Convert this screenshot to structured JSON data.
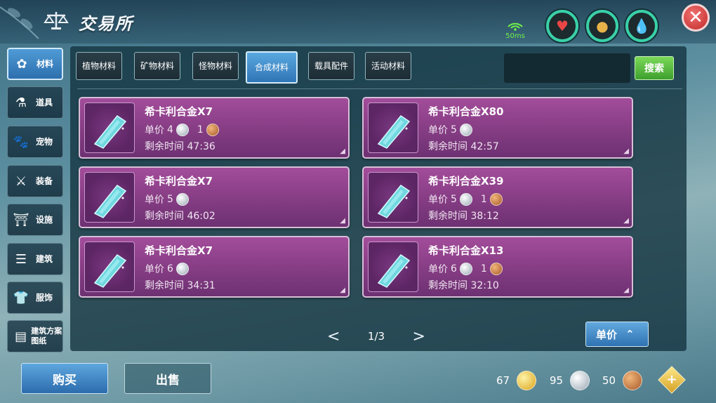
{
  "header": {
    "title": "交易所",
    "ping": "50ms"
  },
  "categories": [
    {
      "label": "材料",
      "icon": "materials-icon",
      "active": true
    },
    {
      "label": "道具",
      "icon": "potion-icon",
      "active": false
    },
    {
      "label": "宠物",
      "icon": "paw-icon",
      "active": false
    },
    {
      "label": "装备",
      "icon": "equipment-icon",
      "active": false
    },
    {
      "label": "设施",
      "icon": "facility-icon",
      "active": false
    },
    {
      "label": "建筑",
      "icon": "building-icon",
      "active": false
    },
    {
      "label": "服饰",
      "icon": "clothing-icon",
      "active": false
    },
    {
      "label": "建筑方案图纸",
      "icon": "blueprint-icon",
      "active": false
    }
  ],
  "subtabs": [
    {
      "label": "植物材料",
      "active": false
    },
    {
      "label": "矿物材料",
      "active": false
    },
    {
      "label": "怪物材料",
      "active": false
    },
    {
      "label": "合成材料",
      "active": true
    },
    {
      "label": "载具配件",
      "active": false
    },
    {
      "label": "活动材料",
      "active": false
    }
  ],
  "search": {
    "button_label": "搜索",
    "placeholder": ""
  },
  "listings": [
    {
      "name": "希卡利合金X7",
      "price_label": "单价",
      "silver": "4",
      "bronze": "1",
      "time_label": "剩余时间",
      "time": "47:36"
    },
    {
      "name": "希卡利合金X80",
      "price_label": "单价",
      "silver": "5",
      "bronze": "",
      "time_label": "剩余时间",
      "time": "42:57"
    },
    {
      "name": "希卡利合金X7",
      "price_label": "单价",
      "silver": "5",
      "bronze": "",
      "time_label": "剩余时间",
      "time": "46:02"
    },
    {
      "name": "希卡利合金X39",
      "price_label": "单价",
      "silver": "5",
      "bronze": "1",
      "time_label": "剩余时间",
      "time": "38:12"
    },
    {
      "name": "希卡利合金X7",
      "price_label": "单价",
      "silver": "6",
      "bronze": "",
      "time_label": "剩余时间",
      "time": "34:31"
    },
    {
      "name": "希卡利合金X13",
      "price_label": "单价",
      "silver": "6",
      "bronze": "1",
      "time_label": "剩余时间",
      "time": "32:10"
    }
  ],
  "pager": {
    "page": "1/3",
    "prev": "<",
    "next": ">"
  },
  "sort": {
    "label": "单价"
  },
  "bottom": {
    "buy_label": "购买",
    "sell_label": "出售"
  },
  "wallet": {
    "gold": "67",
    "silver": "95",
    "bronze": "50",
    "plus": "+"
  },
  "colors": {
    "accent_blue": "#2f75b6",
    "listing_purple": "#8a3f87",
    "search_green": "#3ea02e",
    "close_red": "#c22a2a"
  }
}
